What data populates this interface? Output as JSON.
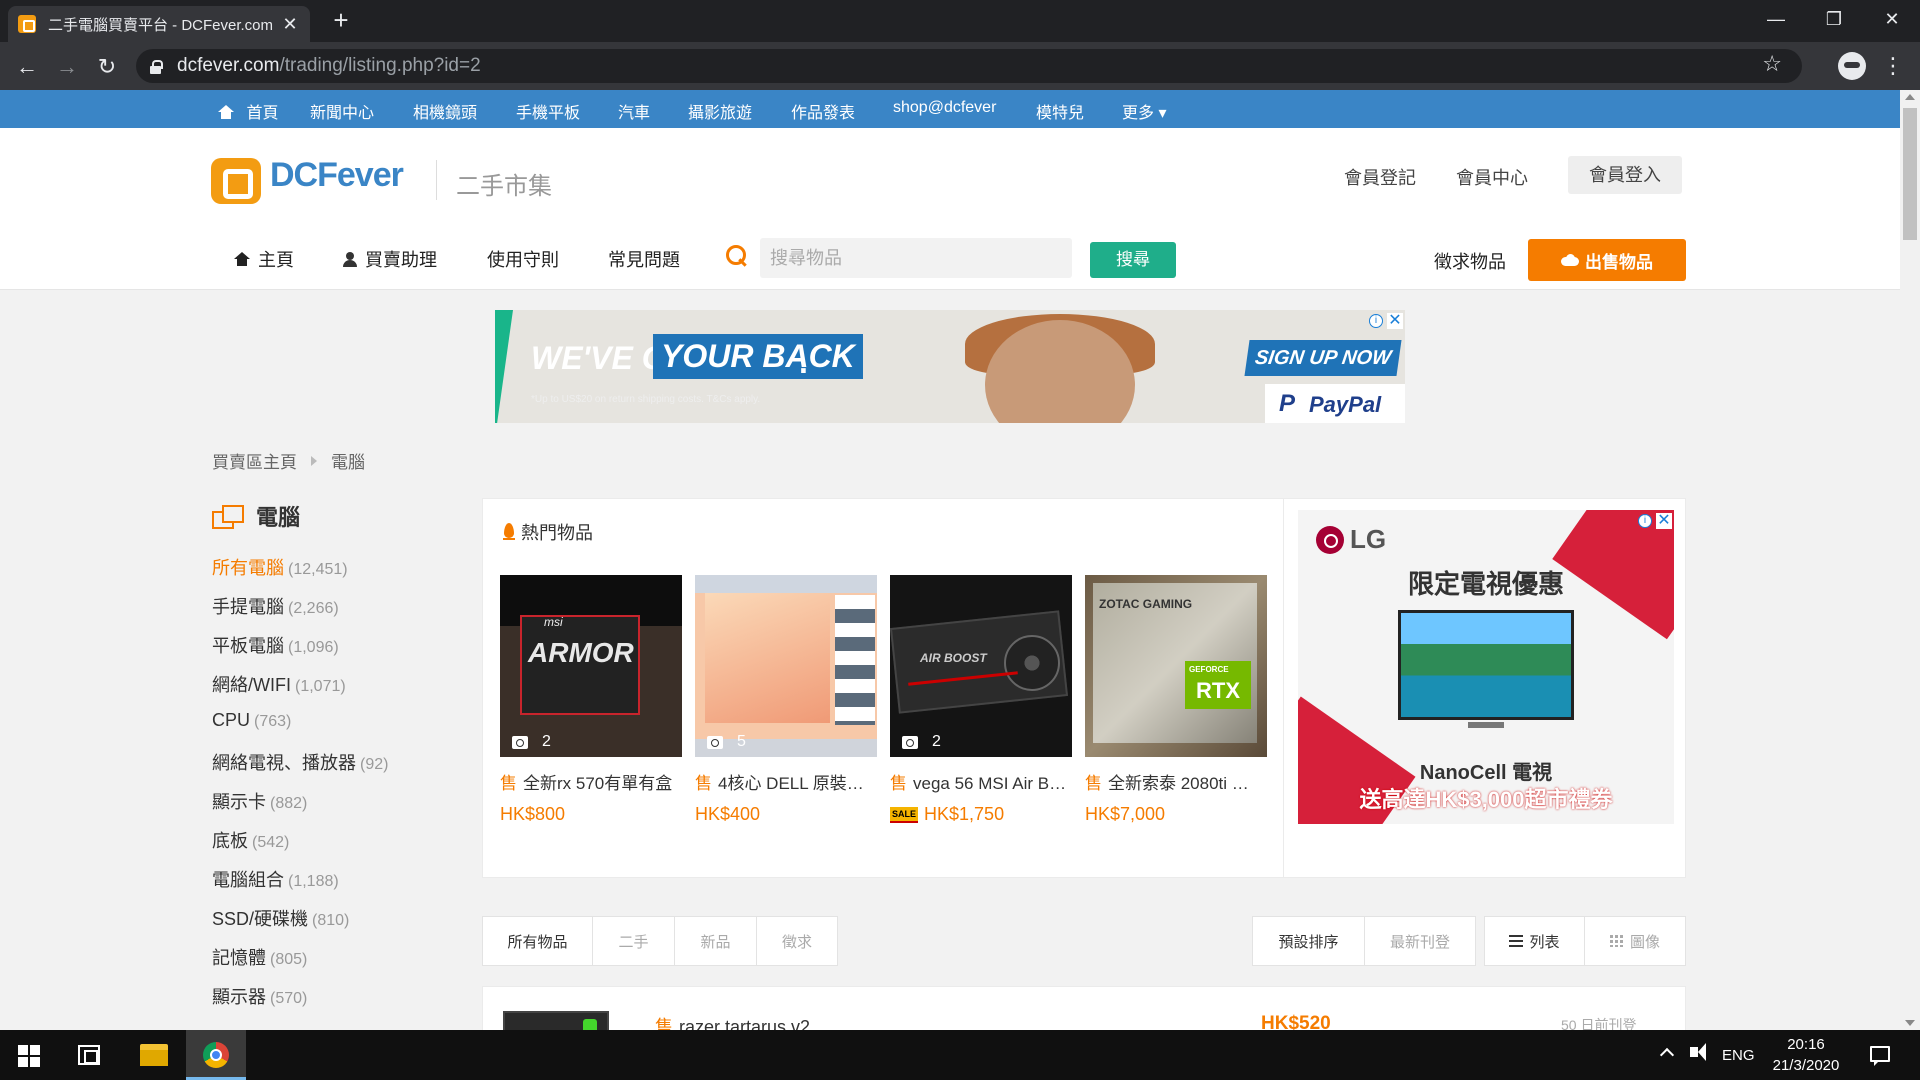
{
  "browser": {
    "tab_title": "二手電腦買賣平台 - DCFever.com",
    "tab_close": "✕",
    "new_tab": "+",
    "url_host": "dcfever.com",
    "url_path": "/trading/listing.php?id=2",
    "back": "←",
    "forward": "→",
    "reload": "↻",
    "star": "☆",
    "menu": "⋮",
    "minimize": "—",
    "restore": "❐",
    "close": "✕"
  },
  "site_nav": {
    "items": [
      "首頁",
      "新聞中心",
      "相機鏡頭",
      "手機平板",
      "汽車",
      "攝影旅遊",
      "作品發表",
      "shop@dcfever",
      "模特兒",
      "更多 ▾"
    ]
  },
  "header": {
    "logo": "DCFever",
    "section": "二手市集",
    "register": "會員登記",
    "member_center": "會員中心",
    "login": "會員登入"
  },
  "main_nav": {
    "home": "主頁",
    "assistant": "買賣助理",
    "rules": "使用守則",
    "faq": "常見問題",
    "search_placeholder": "搜尋物品",
    "search_button": "搜尋",
    "wanted": "徵求物品",
    "sell": "出售物品"
  },
  "ad_banner": {
    "line1": "WE'VE GOT",
    "line2": "YOUR BACK",
    "dot": ".",
    "fine_print": "*Up to US$20 on return shipping costs. T&Cs apply.",
    "cta": "SIGN UP NOW",
    "brand": "PayPal",
    "brand_mark": "P"
  },
  "breadcrumb": {
    "home": "買賣區主頁",
    "current": "電腦"
  },
  "sidebar": {
    "title": "電腦",
    "items": [
      {
        "label": "所有電腦",
        "count": "(12,451)"
      },
      {
        "label": "手提電腦",
        "count": "(2,266)"
      },
      {
        "label": "平板電腦",
        "count": "(1,096)"
      },
      {
        "label": "網絡/WIFI",
        "count": "(1,071)"
      },
      {
        "label": "CPU",
        "count": "(763)"
      },
      {
        "label": "網絡電視、播放器",
        "count": "(92)"
      },
      {
        "label": "顯示卡",
        "count": "(882)"
      },
      {
        "label": "底板",
        "count": "(542)"
      },
      {
        "label": "電腦組合",
        "count": "(1,188)"
      },
      {
        "label": "SSD/硬碟機",
        "count": "(810)"
      },
      {
        "label": "記憶體",
        "count": "(805)"
      },
      {
        "label": "顯示器",
        "count": "(570)"
      }
    ]
  },
  "hot": {
    "title": "熱門物品",
    "items": [
      {
        "tag": "售",
        "title": "全新rx 570有單有盒",
        "price": "HK$800",
        "photos": "2",
        "thumb_text": "ARMOR",
        "thumb_brand": "msi"
      },
      {
        "tag": "售",
        "title": "4核心 DELL 原裝…",
        "price": "HK$400",
        "photos": "5"
      },
      {
        "tag": "售",
        "title": "vega 56 MSI Air B…",
        "price": "HK$1,750",
        "photos": "2",
        "sale_badge": "SALE",
        "thumb_text": "AIR BOOST"
      },
      {
        "tag": "售",
        "title": "全新索泰 2080ti …",
        "price": "HK$7,000",
        "thumb_text": "ZOTAC GAMING",
        "thumb_badge": "RTX"
      }
    ]
  },
  "ad_lg": {
    "brand": "LG",
    "headline": "限定電視優惠",
    "sub1": "NanoCell 電視",
    "sub2": "送高達HK$3,000超市禮券"
  },
  "filters": {
    "type": [
      "所有物品",
      "二手",
      "新品",
      "徵求"
    ],
    "sort": [
      "預設排序",
      "最新刊登"
    ],
    "view": [
      "列表",
      "圖像"
    ]
  },
  "listing": {
    "tag": "售",
    "title": "razer tartarus v2",
    "price": "HK$520",
    "age": "50 日前刊登"
  },
  "taskbar": {
    "lang": "ENG",
    "time": "20:16",
    "date": "21/3/2020"
  },
  "colors": {
    "brand_blue": "#3a85c6",
    "accent_orange": "#f57c00",
    "search_green": "#1fae8a"
  }
}
